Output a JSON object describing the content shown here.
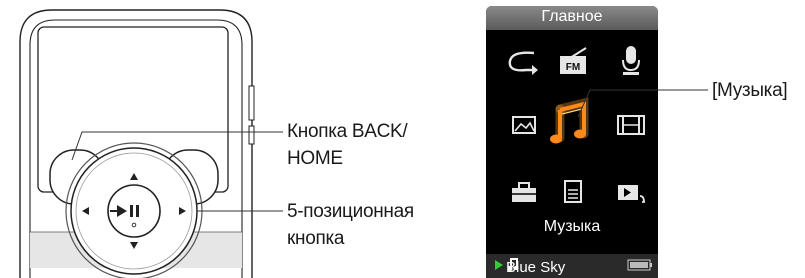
{
  "callouts": {
    "back_home_line1": "Кнопка BACK/",
    "back_home_line2": "HOME",
    "five_way_line1": "5-позиционная",
    "five_way_line2": "кнопка",
    "music_callout": "[Музыка]"
  },
  "screen": {
    "title": "Главное",
    "selected_item_label": "Музыка",
    "now_playing_track": "Blue Sky",
    "menu_icons": [
      "shuffle-icon",
      "fm-radio-icon",
      "microphone-icon",
      "photo-icon",
      "music-note-icon",
      "video-icon",
      "settings-toolbox-icon",
      "document-icon",
      "now-playing-icon"
    ],
    "fm_badge": "FM"
  },
  "colors": {
    "screen_bg": "#000000",
    "title_bar": "#6e6e6e",
    "selected_glow": "#f0a030",
    "icon_color": "#e6e6e6",
    "status_play": "#33cc33"
  }
}
